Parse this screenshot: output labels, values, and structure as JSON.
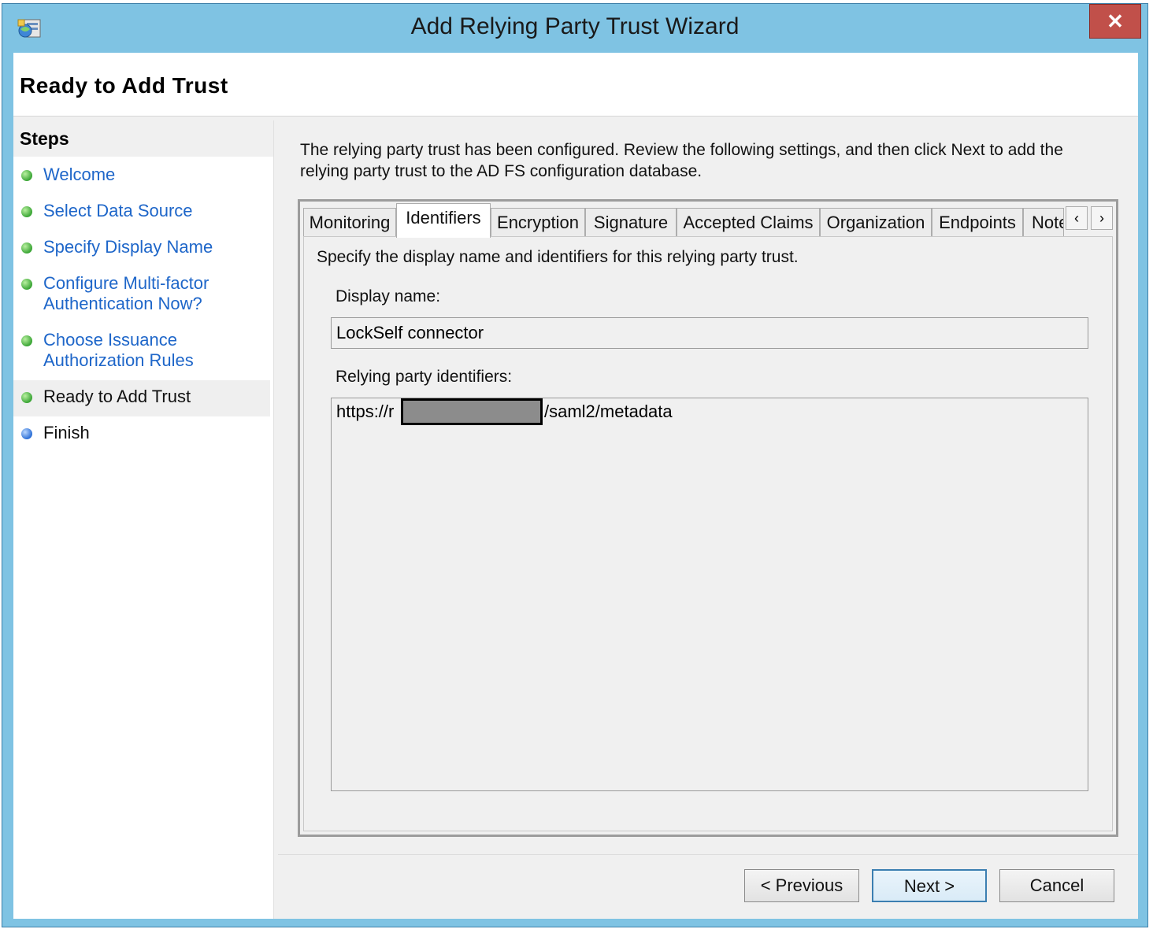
{
  "window": {
    "title": "Add Relying Party Trust Wizard",
    "close_glyph": "✕"
  },
  "header": {
    "page_title": "Ready to Add Trust"
  },
  "steps": {
    "heading": "Steps",
    "items": [
      {
        "label": "Welcome",
        "state": "done"
      },
      {
        "label": "Select Data Source",
        "state": "done"
      },
      {
        "label": "Specify Display Name",
        "state": "done"
      },
      {
        "label_line1": "Configure Multi-factor",
        "label_line2": "Authentication Now?",
        "state": "done"
      },
      {
        "label_line1": "Choose Issuance",
        "label_line2": "Authorization Rules",
        "state": "done"
      },
      {
        "label": "Ready to Add Trust",
        "state": "current"
      },
      {
        "label": "Finish",
        "state": "pending"
      }
    ]
  },
  "intro_text_line1": "The relying party trust has been configured. Review the following settings, and then click Next to add the",
  "intro_text_line2": "relying party trust to the AD FS configuration database.",
  "tabs": {
    "items": [
      "Monitoring",
      "Identifiers",
      "Encryption",
      "Signature",
      "Accepted Claims",
      "Organization",
      "Endpoints",
      "Note"
    ],
    "active": "Identifiers",
    "scroll_left": "‹",
    "scroll_right": "›"
  },
  "identifiers_tab": {
    "description": "Specify the display name and identifiers for this relying party trust.",
    "display_name_label": "Display name:",
    "display_name_value": "LockSelf connector",
    "identifiers_label": "Relying party identifiers:",
    "identifier_prefix": "https://r",
    "identifier_suffix": "/saml2/metadata"
  },
  "buttons": {
    "previous": "< Previous",
    "next": "Next >",
    "cancel": "Cancel"
  },
  "colors": {
    "titlebar": "#7fc3e3",
    "close": "#c1504a",
    "link": "#1e66c9",
    "done_dot": "#3aa535",
    "pending_dot": "#2c6fd6"
  }
}
